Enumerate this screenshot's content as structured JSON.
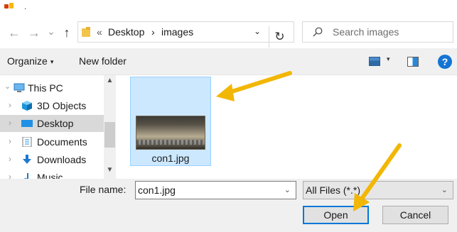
{
  "title": {
    "text": "."
  },
  "nav": {
    "back_icon": "arrow-left",
    "forward_icon": "arrow-right",
    "recent_icon": "chevron-down",
    "up_icon": "arrow-up",
    "back_glyph": "←",
    "forward_glyph": "→",
    "recent_glyph": "⌄",
    "up_glyph": "↑",
    "overflow": "«",
    "breadcrumb": [
      "Desktop",
      "images"
    ],
    "separator": "›",
    "dropdown_glyph": "⌄",
    "refresh_glyph": "↻",
    "search_placeholder": "Search images"
  },
  "toolbar": {
    "organize_label": "Organize",
    "organize_arrow": "▾",
    "new_folder_label": "New folder",
    "view_arrow": "▾",
    "help_glyph": "?"
  },
  "sidebar": {
    "items": [
      {
        "label": "This PC",
        "chevron": "⌄",
        "icon": "computer"
      },
      {
        "label": "3D Objects",
        "chevron": "›",
        "icon": "cube"
      },
      {
        "label": "Desktop",
        "chevron": "›",
        "icon": "desktop"
      },
      {
        "label": "Documents",
        "chevron": "›",
        "icon": "document"
      },
      {
        "label": "Downloads",
        "chevron": "›",
        "icon": "download"
      },
      {
        "label": "Music",
        "chevron": "›",
        "icon": "music"
      }
    ],
    "scroll_up_glyph": "▲",
    "scroll_down_glyph": "▼"
  },
  "files": [
    {
      "name": "con1.jpg",
      "selected": true
    }
  ],
  "bottom": {
    "file_name_label": "File name:",
    "file_name_value": "con1.jpg",
    "filter_value": "All Files (*.*)",
    "dropdown_glyph": "⌄",
    "open_label": "Open",
    "cancel_label": "Cancel"
  },
  "colors": {
    "selection": "#cce8ff",
    "accent": "#0078d7",
    "annotation_arrow": "#f2b705"
  }
}
